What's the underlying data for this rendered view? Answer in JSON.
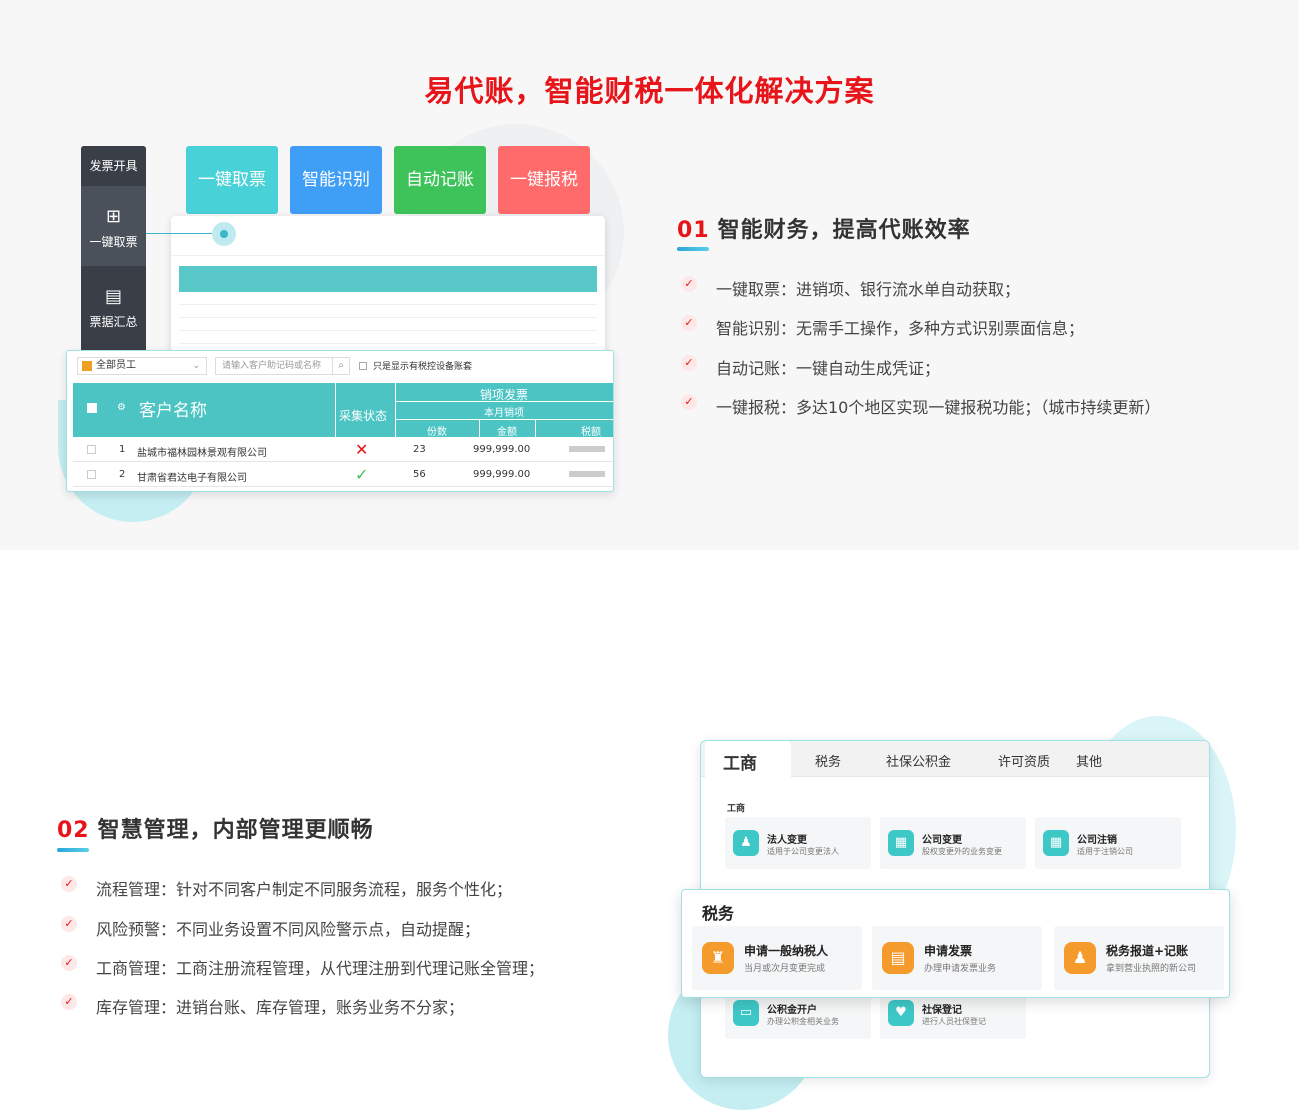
{
  "title": "易代账，智能财税一体化解决方案",
  "sidenav": {
    "header": "发票开具",
    "items": [
      {
        "icon": "ticket-plus-icon",
        "glyph": "⊞",
        "label": "一键取票"
      },
      {
        "icon": "stack-icon",
        "glyph": "▤",
        "label": "票据汇总"
      }
    ]
  },
  "tiles": [
    {
      "label": "一键取票",
      "color": "#49d1d8"
    },
    {
      "label": "智能识别",
      "color": "#3f9ef6"
    },
    {
      "label": "自动记账",
      "color": "#3ec35a"
    },
    {
      "label": "一键报税",
      "color": "#ff6a6a"
    }
  ],
  "front_table": {
    "select_label": "全部员工",
    "search_placeholder": "请输入客户助记码或名称",
    "only_label": "只是显示有税控设备账套",
    "headers": {
      "customer": "客户名称",
      "status": "采集状态",
      "group": "销项发票",
      "sub": "本月销项",
      "count": "份数",
      "amount": "金额",
      "tax": "税额"
    },
    "rows": [
      {
        "index": "1",
        "name": "盐城市福林园林景观有限公司",
        "status": "✕",
        "status_color": "#e7141a",
        "count": "23",
        "amount": "999,999.00"
      },
      {
        "index": "2",
        "name": "甘肃省君达电子有限公司",
        "status": "✓",
        "status_color": "#3ec35a",
        "count": "56",
        "amount": "999,999.00"
      }
    ]
  },
  "section1": {
    "num": "01",
    "heading": "智能财务，提高代账效率",
    "bullets": [
      "一键取票：进销项、银行流水单自动获取；",
      "智能识别：无需手工操作，多种方式识别票面信息；",
      "自动记账：一键自动生成凭证；",
      "一键报税：多达10个地区实现一键报税功能；（城市持续更新）"
    ]
  },
  "section2": {
    "num": "02",
    "heading": "智慧管理，内部管理更顺畅",
    "bullets": [
      "流程管理：针对不同客户制定不同服务流程，服务个性化；",
      "风险预警：不同业务设置不同风险警示点，自动提醒；",
      "工商管理：工商注册流程管理，从代理注册到代理记账全管理；",
      "库存管理：进销台账、库存管理，账务业务不分家；"
    ]
  },
  "win2": {
    "tabs": [
      "工商",
      "税务",
      "社保公积金",
      "许可资质",
      "其他"
    ],
    "group_label": "工商",
    "cards": [
      {
        "title": "法人变更",
        "desc": "适用于公司变更法人",
        "glyph": "♟"
      },
      {
        "title": "公司变更",
        "desc": "股权变更外的业务变更",
        "glyph": "▦"
      },
      {
        "title": "公司注销",
        "desc": "适用于注销公司",
        "glyph": "▦"
      },
      {
        "title": "公积金开户",
        "desc": "办理公积金相关业务",
        "glyph": "▭"
      },
      {
        "title": "社保登记",
        "desc": "进行人员社保登记",
        "glyph": "♥"
      }
    ],
    "popup": {
      "heading": "税务",
      "cards": [
        {
          "title": "申请一般纳税人",
          "desc": "当月或次月变更完成",
          "glyph": "♜"
        },
        {
          "title": "申请发票",
          "desc": "办理申请发票业务",
          "glyph": "▤"
        },
        {
          "title": "税务报道+记账",
          "desc": "拿到营业执照的新公司",
          "glyph": "♟"
        }
      ]
    }
  }
}
